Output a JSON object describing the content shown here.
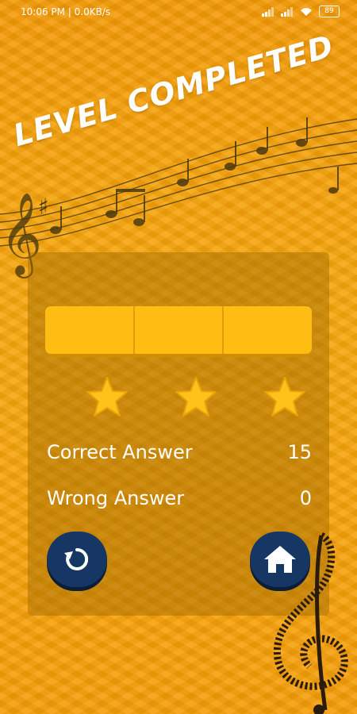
{
  "status_bar": {
    "time": "10:06 PM | 0.0KB/s",
    "battery": "89"
  },
  "title": "LEVEL COMPLETED",
  "progress": {
    "segments_total": 3,
    "segments_filled": 3
  },
  "rating": {
    "stars": 3,
    "max_stars": 3
  },
  "results": {
    "correct_label": "Correct Answer",
    "correct_value": "15",
    "wrong_label": "Wrong Answer",
    "wrong_value": "0"
  },
  "buttons": {
    "replay": "replay-icon",
    "home": "home-icon"
  },
  "colors": {
    "accent": "#ffbd13",
    "star": "#ffc21a",
    "button": "#163663"
  }
}
